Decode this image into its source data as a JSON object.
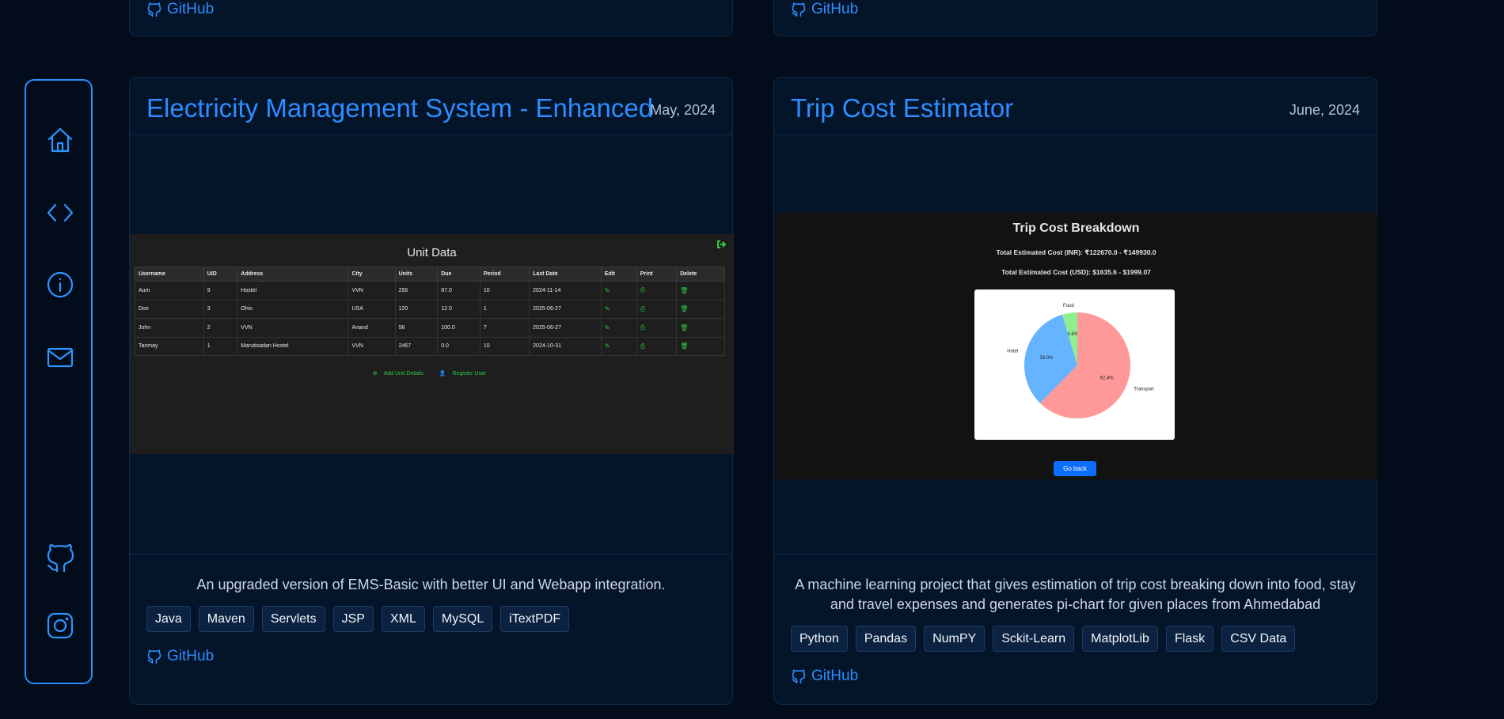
{
  "sidebar": {
    "icons": [
      "home-icon",
      "code-icon",
      "info-icon",
      "mail-icon",
      "github-icon",
      "instagram-icon"
    ]
  },
  "top_cards": [
    {
      "github_label": "GitHub"
    },
    {
      "github_label": "GitHub"
    }
  ],
  "projects": [
    {
      "title": "Electricity Management System - Enhanced",
      "date": "May, 2024",
      "description": "An upgraded version of EMS-Basic with better UI and Webapp integration.",
      "tags": [
        "Java",
        "Maven",
        "Servlets",
        "JSP",
        "XML",
        "MySQL",
        "iTextPDF"
      ],
      "github_label": "GitHub",
      "preview": {
        "title": "Unit Data",
        "columns": [
          "Username",
          "UID",
          "Address",
          "City",
          "Units",
          "Due",
          "Period",
          "Last Date",
          "Edit",
          "Print",
          "Delete"
        ],
        "rows": [
          [
            "Aum",
            "9",
            "Hostel",
            "VVN",
            "256",
            "87.0",
            "10",
            "2024-11-14"
          ],
          [
            "Doe",
            "3",
            "Ohio",
            "USA",
            "120",
            "12.0",
            "1",
            "2025-06-27"
          ],
          [
            "John",
            "2",
            "VVN",
            "Anand",
            "56",
            "100.0",
            "7",
            "2025-06-27"
          ],
          [
            "Tanmay",
            "1",
            "Maruti­sadan Hostel",
            "VVN",
            "2467",
            "0.0",
            "10",
            "2024-10-31"
          ]
        ],
        "add_label": "Add Unit Details",
        "register_label": "Register User"
      }
    },
    {
      "title": "Trip Cost Estimator",
      "date": "June, 2024",
      "description": "A machine learning project that gives estimation of trip cost breaking down into food, stay and travel expenses and generates pi-chart for given places from Ahmedabad",
      "tags": [
        "Python",
        "Pandas",
        "NumPY",
        "Sckit-Learn",
        "MatplotLib",
        "Flask",
        "CSV Data"
      ],
      "github_label": "GitHub",
      "preview": {
        "title": "Trip Cost Breakdown",
        "inr_line": "Total Estimated Cost (INR): ₹122670.0 - ₹149930.0",
        "usd_line": "Total Estimated Cost (USD): $1635.6 - $1999.07",
        "button": "Go back"
      }
    }
  ],
  "chart_data": {
    "type": "pie",
    "title": "",
    "categories": [
      "Food",
      "Hotel",
      "Transport"
    ],
    "values": [
      4.6,
      33.0,
      62.4
    ],
    "value_labels": [
      "4.6%",
      "33.0%",
      "62.4%"
    ],
    "colors": [
      "#90ee90",
      "#66b3ff",
      "#ff9999"
    ]
  }
}
